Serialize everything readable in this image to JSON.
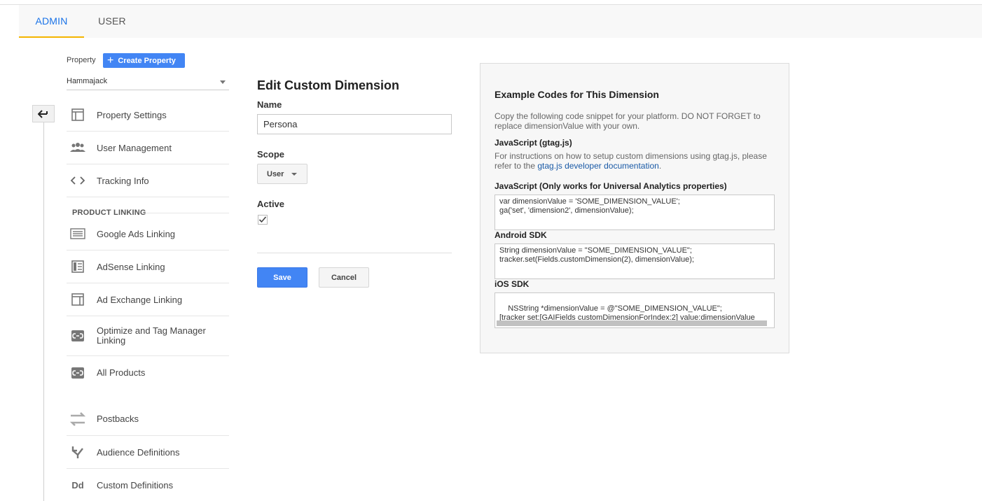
{
  "tabs": {
    "admin": "ADMIN",
    "user": "USER"
  },
  "property": {
    "label": "Property",
    "create_button": "Create Property",
    "selected": "Hammajack"
  },
  "nav": {
    "items": [
      {
        "label": "Property Settings",
        "icon": "layout-icon"
      },
      {
        "label": "User Management",
        "icon": "people-icon"
      },
      {
        "label": "Tracking Info",
        "icon": "code-icon"
      }
    ],
    "section_heading": "PRODUCT LINKING",
    "linking_items": [
      {
        "label": "Google Ads Linking",
        "icon": "ads-icon"
      },
      {
        "label": "AdSense Linking",
        "icon": "adsense-icon"
      },
      {
        "label": "Ad Exchange Linking",
        "icon": "ad-exchange-icon"
      },
      {
        "label": "Optimize and Tag Manager Linking",
        "icon": "link-icon"
      },
      {
        "label": "All Products",
        "icon": "link-icon"
      }
    ],
    "other_items": [
      {
        "label": "Postbacks",
        "icon": "postbacks-icon"
      },
      {
        "label": "Audience Definitions",
        "icon": "audience-icon"
      },
      {
        "label": "Custom Definitions",
        "icon": "dd-icon",
        "icon_text": "Dd"
      }
    ]
  },
  "form": {
    "title": "Edit Custom Dimension",
    "name_label": "Name",
    "name_value": "Persona",
    "scope_label": "Scope",
    "scope_value": "User",
    "active_label": "Active",
    "active_checked": true,
    "save": "Save",
    "cancel": "Cancel"
  },
  "examples": {
    "title": "Example Codes for This Dimension",
    "description": "Copy the following code snippet for your platform. DO NOT FORGET to replace dimensionValue with your own.",
    "gtag_heading": "JavaScript (gtag.js)",
    "gtag_text_before": "For instructions on how to setup custom dimensions using gtag.js, please refer to the ",
    "gtag_link": "gtag.js developer documentation",
    "gtag_text_after": ".",
    "ua_heading": "JavaScript (Only works for Universal Analytics properties)",
    "ua_code": "var dimensionValue = 'SOME_DIMENSION_VALUE';\nga('set', 'dimension2', dimensionValue);",
    "android_heading": "Android SDK",
    "android_code": "String dimensionValue = \"SOME_DIMENSION_VALUE\";\ntracker.set(Fields.customDimension(2), dimensionValue);",
    "ios_heading": "iOS SDK",
    "ios_code": "NSString *dimensionValue = @\"SOME_DIMENSION_VALUE\";\n[tracker set:[GAIFields customDimensionForIndex:2] value:dimensionValue"
  }
}
